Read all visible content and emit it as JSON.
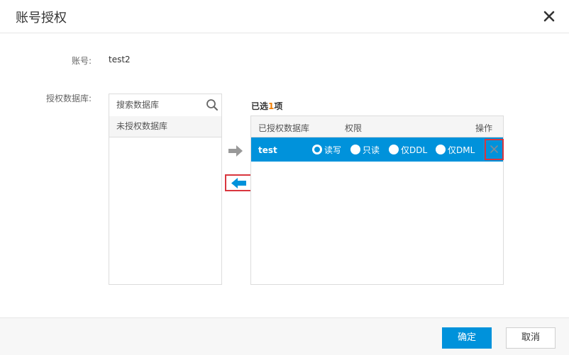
{
  "dialog": {
    "title": "账号授权"
  },
  "form": {
    "account_label": "账号:",
    "account_value": "test2",
    "db_label": "授权数据库:"
  },
  "left_panel": {
    "search_placeholder": "搜索数据库",
    "header": "未授权数据库"
  },
  "right_panel": {
    "count_prefix": "已选",
    "count": "1",
    "count_suffix": "项",
    "columns": {
      "database": "已授权数据库",
      "permission": "权限",
      "action": "操作"
    },
    "rows": [
      {
        "name": "test",
        "options": [
          "读写",
          "只读",
          "仅DDL",
          "仅DML"
        ],
        "selected": "读写"
      }
    ]
  },
  "footer": {
    "ok_label": "确定",
    "cancel_label": "取消"
  },
  "colors": {
    "accent": "#0092db",
    "highlight_border": "#d9363e",
    "count_color": "#f07c00"
  }
}
